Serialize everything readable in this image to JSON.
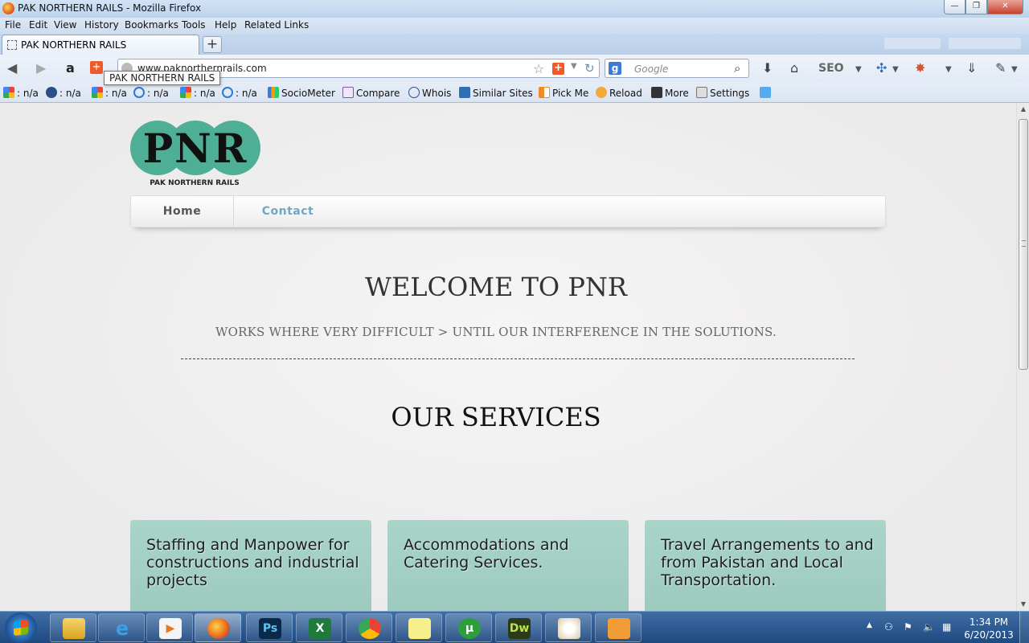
{
  "window": {
    "title": "PAK NORTHERN RAILS - Mozilla Firefox",
    "min_label": "—",
    "max_label": "❐",
    "close_label": "✕"
  },
  "menu": [
    "File",
    "Edit",
    "View",
    "History",
    "Bookmarks",
    "Tools",
    "Help",
    "Related Links"
  ],
  "tab": {
    "label": "PAK NORTHERN RAILS",
    "new_tab_label": "+"
  },
  "urlbar": {
    "url": "www.paknorthernrails.com"
  },
  "search": {
    "engine_letter": "g",
    "placeholder": "Google"
  },
  "tooltip": "PAK NORTHERN RAILS",
  "bookmarks": [
    ": n/a",
    ": n/a",
    ": n/a",
    ": n/a",
    ": n/a",
    ": n/a",
    "SocioMeter",
    "Compare",
    "Whois",
    "Similar Sites",
    "Pick Me",
    "Reload",
    "More",
    "Settings"
  ],
  "toolbar": {
    "seo_label": "SEO"
  },
  "site": {
    "logo_text": "PNR",
    "logo_subtitle": "PAK NORTHERN RAILS",
    "nav": {
      "home": "Home",
      "contact": "Contact"
    },
    "welcome": "WELCOME TO PNR",
    "tagline": "WORKS WHERE VERY DIFFICULT > UNTIL OUR INTERFERENCE IN THE SOLUTIONS.",
    "services_heading": "OUR SERVICES",
    "services": [
      "Staffing and Manpower for constructions and industrial projects",
      "Accommodations and Catering Services.",
      "Travel Arrangements to and from Pakistan and Local Transportation."
    ]
  },
  "taskbar": {
    "apps": [
      "Explorer",
      "Internet Explorer",
      "Media Player",
      "Firefox",
      "Ps",
      "Excel",
      "Chrome",
      "Sticky Notes",
      "uTorrent",
      "Dw",
      "Paint",
      "Photos"
    ],
    "time": "1:34 PM",
    "date": "6/20/2013"
  },
  "colors": {
    "accent": "#6fa8c0",
    "card": "#a8d4ca",
    "logo_green": "#4fae96"
  }
}
